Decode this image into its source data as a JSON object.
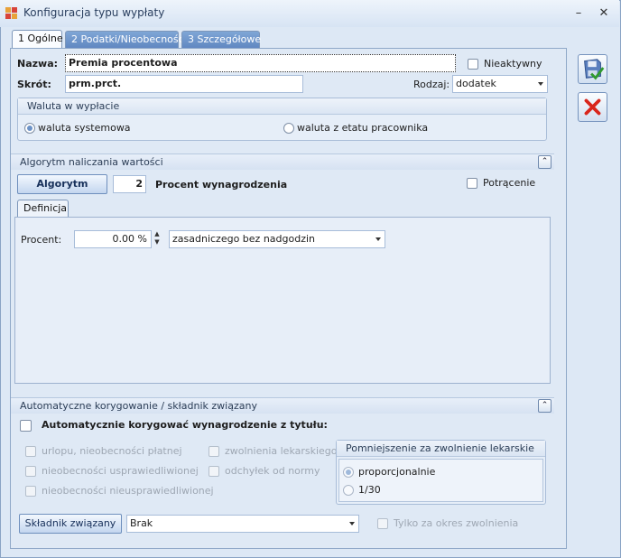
{
  "window": {
    "title": "Konfiguracja typu wypłaty",
    "minimize": "–",
    "close": "✕"
  },
  "tabs": [
    {
      "label": "1 Ogólne",
      "active": true
    },
    {
      "label": "2 Podatki/Nieobecności",
      "active": false
    },
    {
      "label": "3 Szczegółowe",
      "active": false
    }
  ],
  "general": {
    "name_label": "Nazwa:",
    "name_value": "Premia procentowa",
    "inactive_label": "Nieaktywny",
    "short_label": "Skrót:",
    "short_value": "prm.prct.",
    "kind_label": "Rodzaj:",
    "kind_value": "dodatek"
  },
  "currency": {
    "group_title": "Waluta w wypłacie",
    "option_system": "waluta systemowa",
    "option_employee": "waluta z etatu pracownika",
    "selected": "waluta systemowa"
  },
  "algorithm": {
    "section_title": "Algorytm naliczania wartości",
    "button_label": "Algorytm",
    "number": "2",
    "name": "Procent wynagrodzenia",
    "deduction_label": "Potrącenie",
    "def_tab": "Definicja",
    "percent_label": "Procent:",
    "percent_value": "0.00 %",
    "base_value": "zasadniczego bez nadgodzin"
  },
  "auto": {
    "section_title": "Automatyczne korygowanie / składnik związany",
    "main_label": "Automatycznie korygować wynagrodzenie z tytułu:",
    "options": [
      "urlopu, nieobecności płatnej",
      "nieobecności usprawiedliwionej",
      "nieobecności nieusprawiedliwionej",
      "zwolnienia lekarskiego",
      "odchyłek od normy"
    ],
    "reduction_title": "Pomniejszenie za zwolnienie lekarskie",
    "reduction_opt1": "proporcjonalnie",
    "reduction_opt2": "1/30",
    "related_button": "Składnik związany",
    "related_value": "Brak",
    "only_period_label": "Tylko za okres zwolnienia"
  },
  "colors": {
    "accent": "#5f86c0",
    "save_green": "#2f9a2f",
    "cancel_red": "#d9261c"
  }
}
